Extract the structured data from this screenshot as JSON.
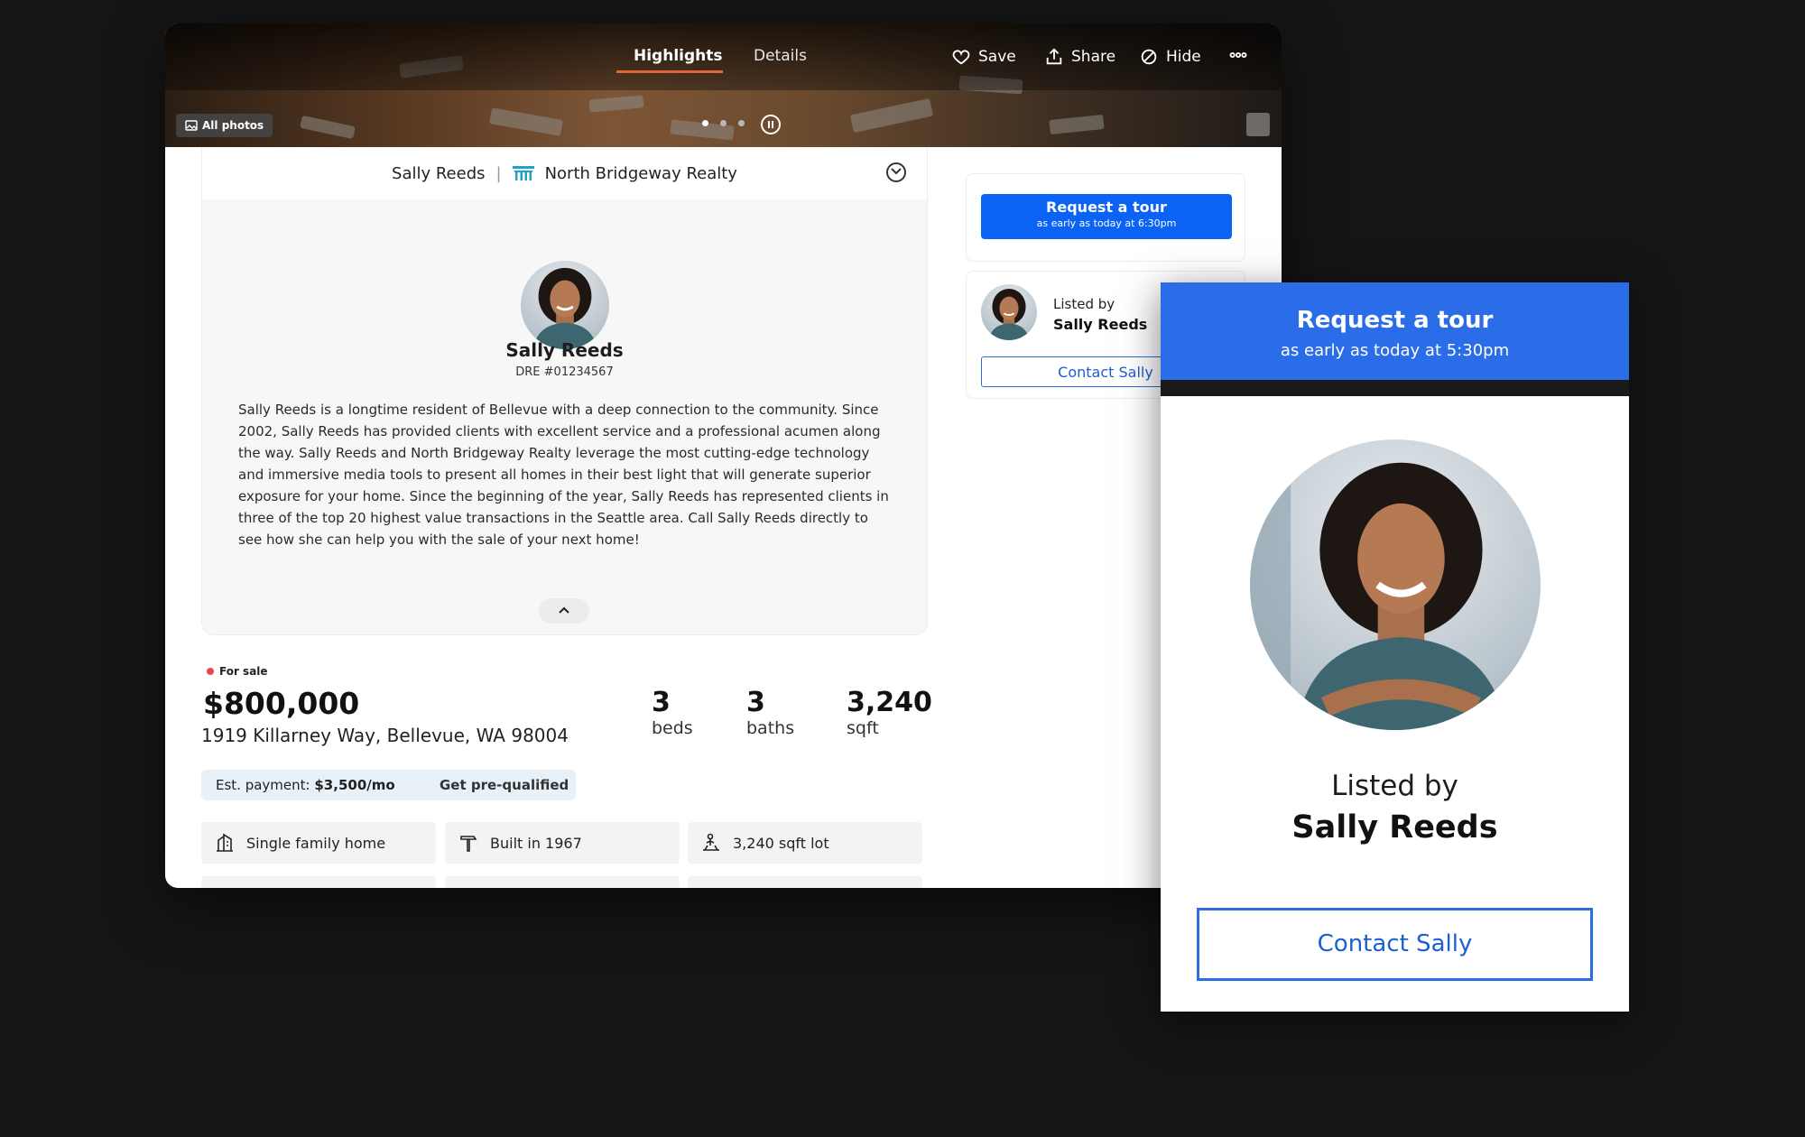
{
  "header": {
    "tabs": [
      {
        "label": "Highlights",
        "active": true
      },
      {
        "label": "Details",
        "active": false
      }
    ],
    "actions": {
      "save": "Save",
      "share": "Share",
      "hide": "Hide"
    },
    "all_photos": "All photos"
  },
  "agent_card": {
    "agent": "Sally Reeds",
    "separator": "|",
    "brokerage": "North Bridgeway Realty",
    "name": "Sally Reeds",
    "dre": "DRE #01234567",
    "bio": "Sally Reeds is a longtime resident of Bellevue with a deep connection to the community. Since 2002, Sally Reeds has provided clients with excellent service and a professional acumen along the way. Sally Reeds and North Bridgeway Realty leverage the most cutting-edge technology and immersive media tools to present all homes in their best light that will generate superior exposure for your home. Since the beginning of the year, Sally Reeds has represented clients in three of the top 20 highest value transactions in the Seattle area. Call Sally Reeds directly to see how she can help you with the sale of your next home!"
  },
  "listing": {
    "status": "For sale",
    "price": "$800,000",
    "address": "1919 Killarney Way, Bellevue, WA 98004",
    "stats": [
      {
        "value": "3",
        "label": "beds"
      },
      {
        "value": "3",
        "label": "baths"
      },
      {
        "value": "3,240",
        "label": "sqft"
      }
    ],
    "payment_label": "Est. payment:",
    "payment_value": "$3,500/mo",
    "prequalify": "Get pre-qualified",
    "features": [
      "Single family home",
      "Built in 1967",
      "3,240 sqft lot"
    ]
  },
  "sidebar": {
    "tour_title": "Request a tour",
    "tour_sub": "as early as today at 6:30pm",
    "listed_by": "Listed by",
    "agent_name": "Sally Reeds",
    "contact": "Contact Sally"
  },
  "popup": {
    "tour_title": "Request a tour",
    "tour_sub": "as early as today at 5:30pm",
    "listed_by": "Listed by",
    "agent_name": "Sally Reeds",
    "contact": "Contact Sally"
  },
  "colors": {
    "accent_blue": "#0b63f5",
    "popup_blue": "#2b6de8",
    "tab_underline": "#e4643a",
    "for_sale_dot": "#e5484d"
  }
}
